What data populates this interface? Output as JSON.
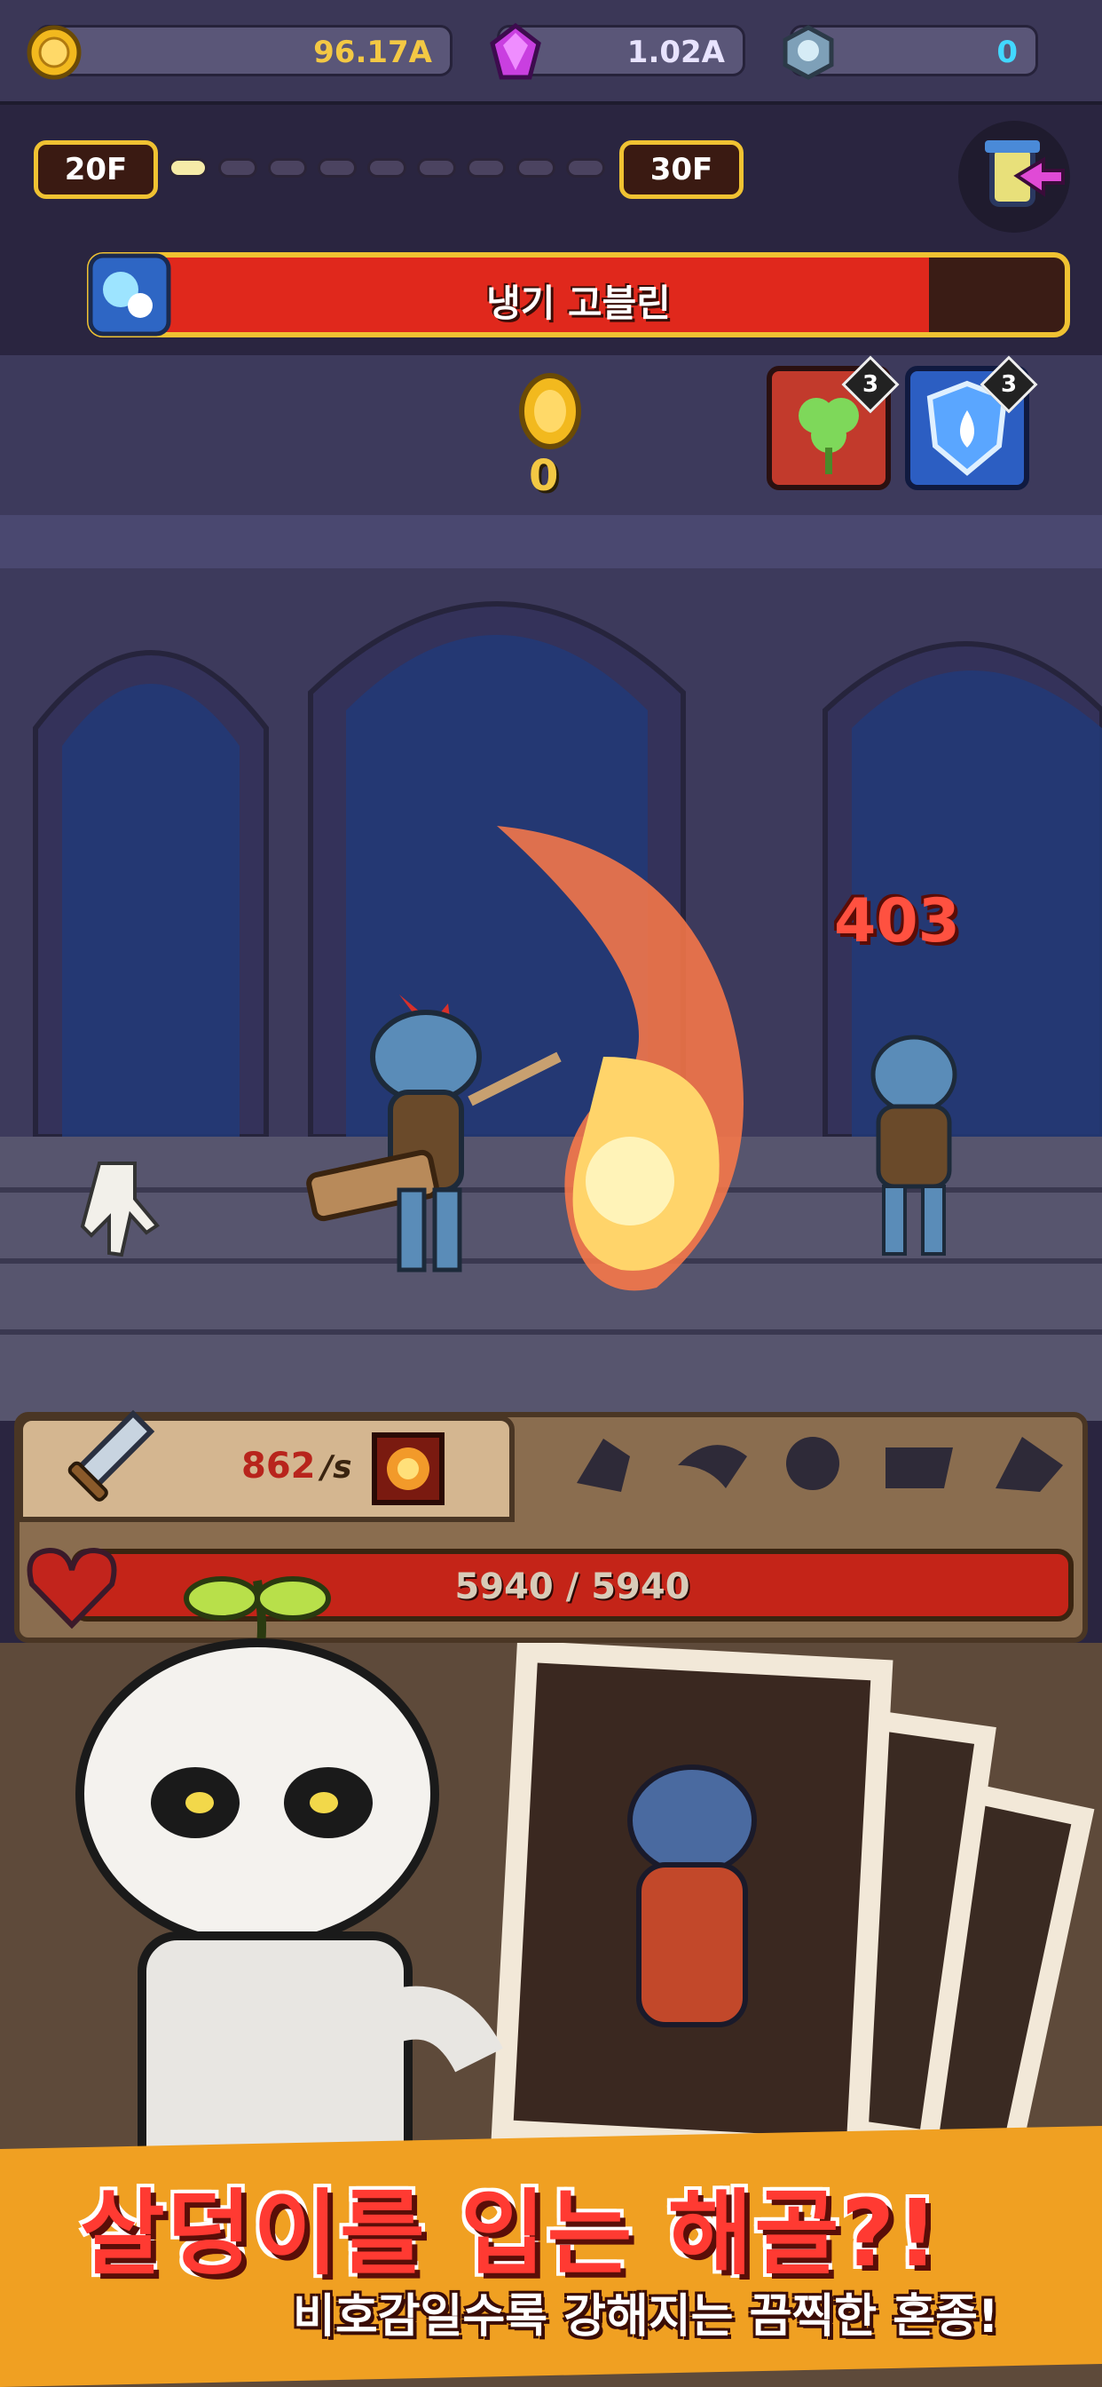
{
  "currencies": {
    "gold": {
      "value": "96.17A",
      "icon": "gold-coin-icon"
    },
    "gem": {
      "value": "1.02A",
      "icon": "purple-gem-icon"
    },
    "token": {
      "value": "0",
      "icon": "skull-token-icon"
    }
  },
  "floor": {
    "start": "20F",
    "end": "30F",
    "progress_dots_total": 9,
    "progress_dots_filled": 1
  },
  "boss": {
    "name": "냉기 고블린",
    "hp_fraction": 0.86,
    "icon": "ice-element-icon"
  },
  "stage": {
    "coins_collected": "0",
    "damage_popup": "403",
    "buffs": [
      {
        "icon": "clover-buff-icon",
        "level": "3"
      },
      {
        "icon": "shield-buff-icon",
        "level": "3"
      }
    ]
  },
  "player": {
    "dps_value": "862",
    "dps_unit": "/s",
    "hp_text": "5940 / 5940",
    "hp_fraction": 1.0,
    "skill_icons": [
      "fist-skill-icon",
      "wing-skill-icon",
      "arrow-skill-icon",
      "dash-skill-icon",
      "runner-skill-icon"
    ]
  },
  "promo": {
    "title": "살덩이를 입는 해골?!",
    "subtitle": "비호감일수록 강해지는 끔찍한 혼종!"
  },
  "colors": {
    "gold_text": "#f3c844",
    "token_text": "#42d8ff",
    "boss_hp": "#e0281c",
    "damage": "#ff5140",
    "banner": "#f0a022"
  }
}
